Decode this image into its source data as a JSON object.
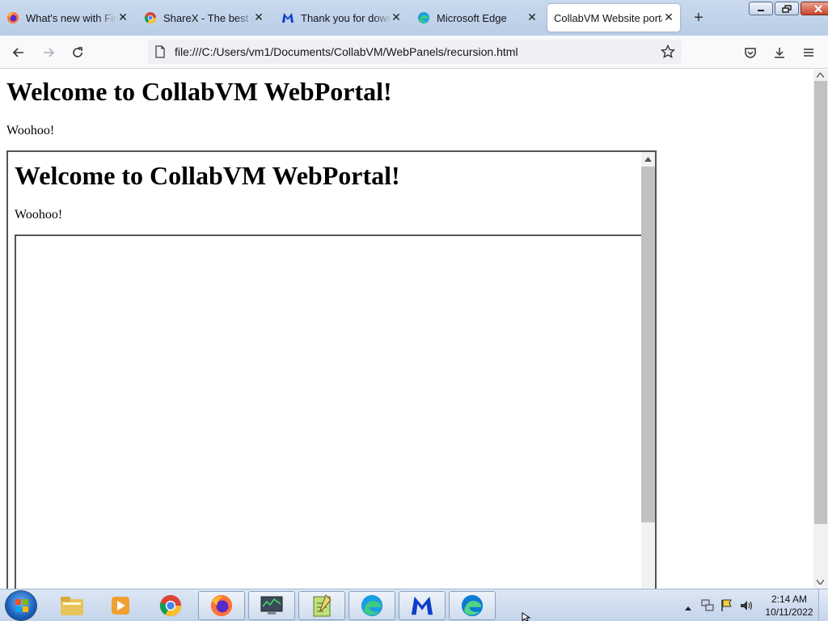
{
  "tabs": [
    {
      "title": "What's new with Firef",
      "icon": "firefox-icon"
    },
    {
      "title": "ShareX - The best free",
      "icon": "chrome-icon"
    },
    {
      "title": "Thank you for downl",
      "icon": "malwarebytes-icon"
    },
    {
      "title": "Microsoft Edge",
      "icon": "edge-icon"
    },
    {
      "title": "CollabVM Website portal",
      "icon": null,
      "active": true
    }
  ],
  "nav": {
    "url": "file:///C:/Users/vm1/Documents/CollabVM/WebPanels/recursion.html"
  },
  "page": {
    "heading": "Welcome to CollabVM WebPortal!",
    "text": "Woohoo!",
    "iframe": {
      "heading": "Welcome to CollabVM WebPortal!",
      "text": "Woohoo!"
    }
  },
  "taskbar": {
    "apps": [
      "explorer-icon",
      "media-player-icon",
      "chrome-icon",
      "firefox-icon",
      "task-manager-icon",
      "notepad-icon",
      "edge-icon",
      "malwarebytes-icon",
      "edge-new-icon"
    ],
    "time": "2:14 AM",
    "date": "10/11/2022"
  },
  "colors": {
    "titlebar": "#c9d9ee",
    "taskbar": "#c3d4ea",
    "url_bg": "#f0f0f4"
  }
}
